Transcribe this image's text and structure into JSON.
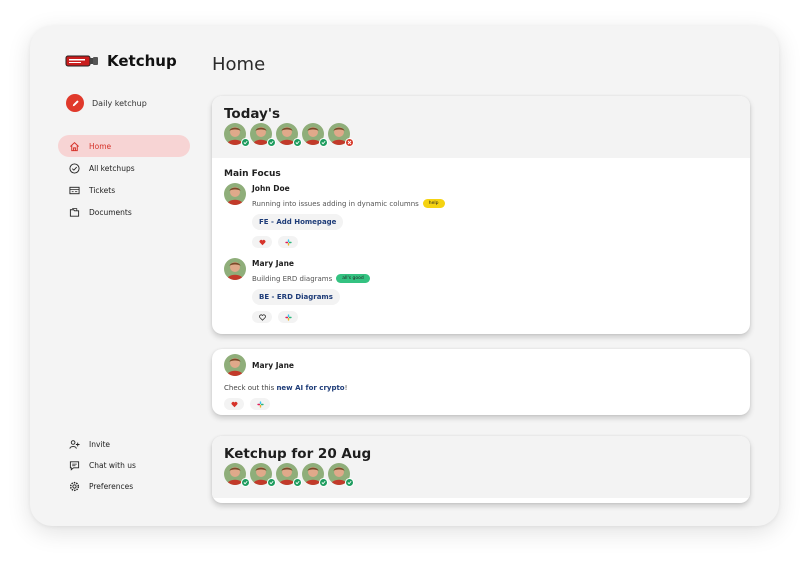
{
  "app": {
    "name": "Ketchup"
  },
  "sidebar": {
    "daily_label": "Daily ketchup",
    "nav": [
      {
        "label": "Home",
        "icon": "home-icon",
        "active": true
      },
      {
        "label": "All ketchups",
        "icon": "check-circle-icon",
        "active": false
      },
      {
        "label": "Tickets",
        "icon": "ticket-icon",
        "active": false
      },
      {
        "label": "Documents",
        "icon": "folder-icon",
        "active": false
      }
    ],
    "bottom": [
      {
        "label": "Invite",
        "icon": "user-plus-icon"
      },
      {
        "label": "Chat with us",
        "icon": "chat-icon"
      },
      {
        "label": "Preferences",
        "icon": "gear-icon"
      }
    ]
  },
  "main": {
    "title": "Home",
    "today": {
      "heading": "Today's",
      "section": "Main Focus",
      "posts": [
        {
          "name": "John Doe",
          "text": "Running into issues adding in dynamic columns",
          "tag": "help",
          "task": "FE - Add Homepage"
        },
        {
          "name": "Mary Jane",
          "text": "Building ERD diagrams",
          "tag": "all's good",
          "task": "BE - ERD Diagrams"
        }
      ]
    },
    "message": {
      "name": "Mary Jane",
      "prefix": "Check out this ",
      "link": "new AI for crypto",
      "suffix": "!"
    },
    "past": {
      "heading": "Ketchup for 20 Aug"
    }
  },
  "colors": {
    "accent": "#e0392b",
    "active_bg": "#f7d4d4",
    "ok": "#1d9c5e",
    "no": "#d63a2a",
    "help_tag": "#f5d312",
    "good_tag": "#34c281"
  }
}
